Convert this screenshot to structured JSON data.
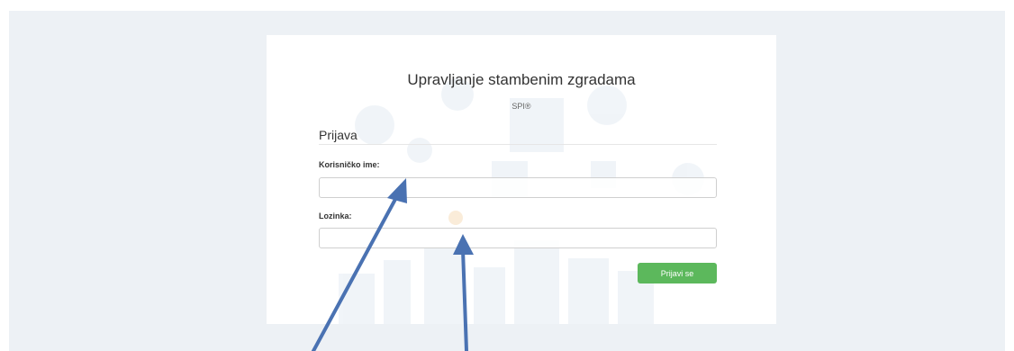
{
  "app": {
    "title": "Upravljanje stambenim zgradama",
    "subtitle": "SPI®"
  },
  "login": {
    "section_title": "Prijava",
    "username_label": "Korisničko ime:",
    "username_value": "",
    "password_label": "Lozinka:",
    "password_value": "",
    "submit_label": "Prijavi se"
  },
  "colors": {
    "accent": "#5cb85c",
    "arrow": "#4a72b2",
    "background": "#edf1f5"
  },
  "icons": [
    "gear-icon",
    "lightbulb-icon",
    "city-skyline-icon",
    "arrow-icon"
  ]
}
